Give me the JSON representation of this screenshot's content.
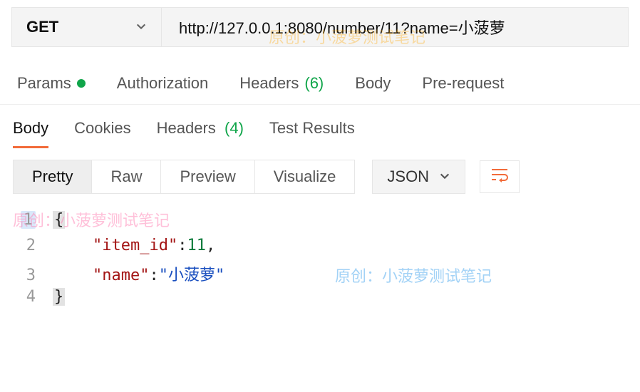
{
  "request": {
    "method": "GET",
    "url": "http://127.0.0.1:8080/number/11?name=小菠萝"
  },
  "reqTabs": {
    "params": "Params",
    "authorization": "Authorization",
    "headers": "Headers",
    "headersCount": "(6)",
    "body": "Body",
    "prerequest": "Pre-request"
  },
  "resTabs": {
    "body": "Body",
    "cookies": "Cookies",
    "headers": "Headers",
    "headersCount": "(4)",
    "tests": "Test Results"
  },
  "viewModes": {
    "pretty": "Pretty",
    "raw": "Raw",
    "preview": "Preview",
    "visualize": "Visualize"
  },
  "format": {
    "selected": "JSON"
  },
  "code": {
    "lines": [
      "1",
      "2",
      "3",
      "4"
    ],
    "l1": "{",
    "l2_key": "\"item_id\"",
    "l2_sep": ": ",
    "l2_val": "11",
    "l2_end": ",",
    "l3_key": "\"name\"",
    "l3_sep": ": ",
    "l3_val": "\"小菠萝\"",
    "l4": "}"
  },
  "watermarks": {
    "wm1": "原创：小菠萝测试笔记",
    "wm2": "原创：小菠萝测试笔记",
    "wm3": "原创：小菠萝测试笔记"
  }
}
